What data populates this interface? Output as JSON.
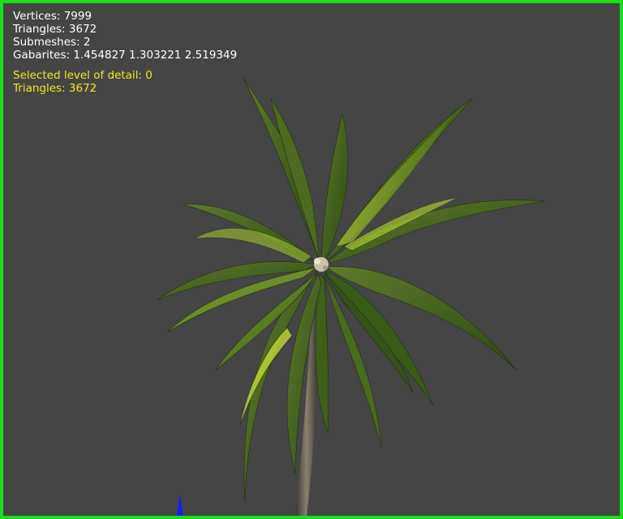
{
  "stats": {
    "vertices": "Vertices: 7999",
    "triangles": "Triangles: 3672",
    "submeshes": "Submeshes: 2",
    "gabarites": "Gabarites: 1.454827 1.303221 2.519349"
  },
  "lod": {
    "selected": "Selected level of detail: 0",
    "triangles": "Triangles: 3672"
  },
  "colors": {
    "background": "#454545",
    "viewport_border": "#18e018",
    "stats_text": "#ffffff",
    "lod_text": "#f2e81c",
    "axis_marker": "#1a1aff"
  }
}
